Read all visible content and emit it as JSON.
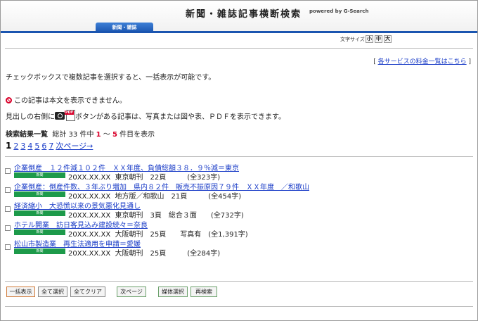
{
  "header": {
    "site_title": "新聞・雑誌記事横断検索",
    "powered_by": "powered by G-Search",
    "active_tab": "新聞・雑誌"
  },
  "font_size": {
    "label": "文字サイズ",
    "small": "小",
    "medium": "中",
    "large": "大"
  },
  "price_link": {
    "bracket_open": "[",
    "label": "各サービスの料金一覧はこちら",
    "bracket_close": "]"
  },
  "notices": {
    "checkbox_hint": "チェックボックスで複数記事を選択すると、一括表示が可能です。",
    "no_body": "この記事は本文を表示できません。",
    "media_hint_prefix": "見出しの右側に",
    "media_hint_suffix": "ボタンがある記事は、写真または図や表、ＰＤＦを表示できます。"
  },
  "summary": {
    "title": "検索結果一覧",
    "total_prefix": "総計 33 件中",
    "from": "1",
    "tilde": "～",
    "to": "5",
    "suffix": "件目を表示"
  },
  "pager": {
    "current": "1",
    "pages": [
      "2",
      "3",
      "4",
      "5",
      "6",
      "7"
    ],
    "next": "次ページ→"
  },
  "results": [
    {
      "title": "企業倒産　１２件減１０２件　ＸＸ年度、負債総額３８．９％減＝東京",
      "category": "新聞",
      "date": "20XX.XX.XX",
      "meta": "東京朝刊　22頁　　　(全323字)"
    },
    {
      "title": "企業倒産：倒産件数、３年ぶり増加　県内８２件　販売不振原因７９件　ＸＸ年度　／和歌山",
      "category": "新聞",
      "date": "20XX.XX.XX",
      "meta": "地方版／和歌山　21頁　　　(全454字)"
    },
    {
      "title": "経済縮小　大恐慌以来の景気悪化見通し",
      "category": "新聞",
      "date": "20XX.XX.XX",
      "meta": "東京朝刊　3頁　総合３面　　(全732字)"
    },
    {
      "title": "ホテル開業　訪日客見込み建設続々＝奈良",
      "category": "新聞",
      "date": "20XX.XX.XX",
      "meta": "大阪朝刊　25頁　　写真有　(全1,391字)"
    },
    {
      "title": "松山市製造業　再生法適用を申請＝愛媛",
      "category": "新聞",
      "date": "20XX.XX.XX",
      "meta": "大阪朝刊　25頁　　　(全284字)"
    }
  ],
  "buttons": {
    "bulk_view": "一括表示",
    "select_all": "全て選択",
    "clear_all": "全てクリア",
    "next_page": "次ページ",
    "media_select": "媒体選択",
    "research": "再検索"
  },
  "colors": {
    "tab_blue": "#1b55b0",
    "link_blue": "#1a3cc7",
    "category_green": "#1d9a4a",
    "accent_red": "#d9002a"
  }
}
